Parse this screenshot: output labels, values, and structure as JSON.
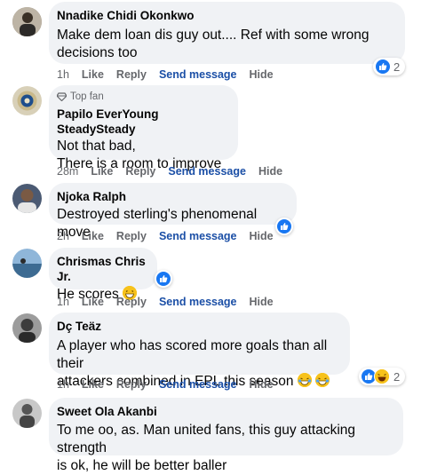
{
  "comments": [
    {
      "author": "Nnadike Chidi Okonkwo",
      "text_lines": [
        "Make dem loan dis guy out.... Ref with some wrong",
        "decisions too"
      ],
      "time": "1h",
      "reaction_count": "2"
    },
    {
      "badge": "Top fan",
      "author": "Papilo EverYoung SteadySteady",
      "text_lines": [
        "Not that bad,",
        "There is a room to improve"
      ],
      "time": "28m"
    },
    {
      "author": "Njoka Ralph",
      "text_lines": [
        "Destroyed sterling's phenomenal move"
      ],
      "time": "2h"
    },
    {
      "author": "Chrismas Chris Jr.",
      "text_lines": [
        "He scores"
      ],
      "time": "1h"
    },
    {
      "author": "Dç Teäz",
      "text_lines": [
        "A player who has scored more goals than all their",
        "attackers combined in EPL this season"
      ],
      "time": "1h",
      "reaction_count": "2"
    },
    {
      "author": "Sweet Ola Akanbi",
      "text_lines": [
        "To me oo, as. Man united fans, this guy attacking strength",
        "is ok, he will be better baller"
      ]
    }
  ],
  "actions": {
    "like": "Like",
    "reply": "Reply",
    "send_message": "Send message",
    "hide": "Hide"
  },
  "icons": {
    "like": "like-reaction-icon",
    "haha": "haha-reaction-icon",
    "top_fan": "diamond-icon"
  },
  "colors": {
    "bubble": "#f0f2f5",
    "like_blue": "#1877f2",
    "send_message": "#1b4fa6",
    "secondary_text": "#65676b"
  }
}
